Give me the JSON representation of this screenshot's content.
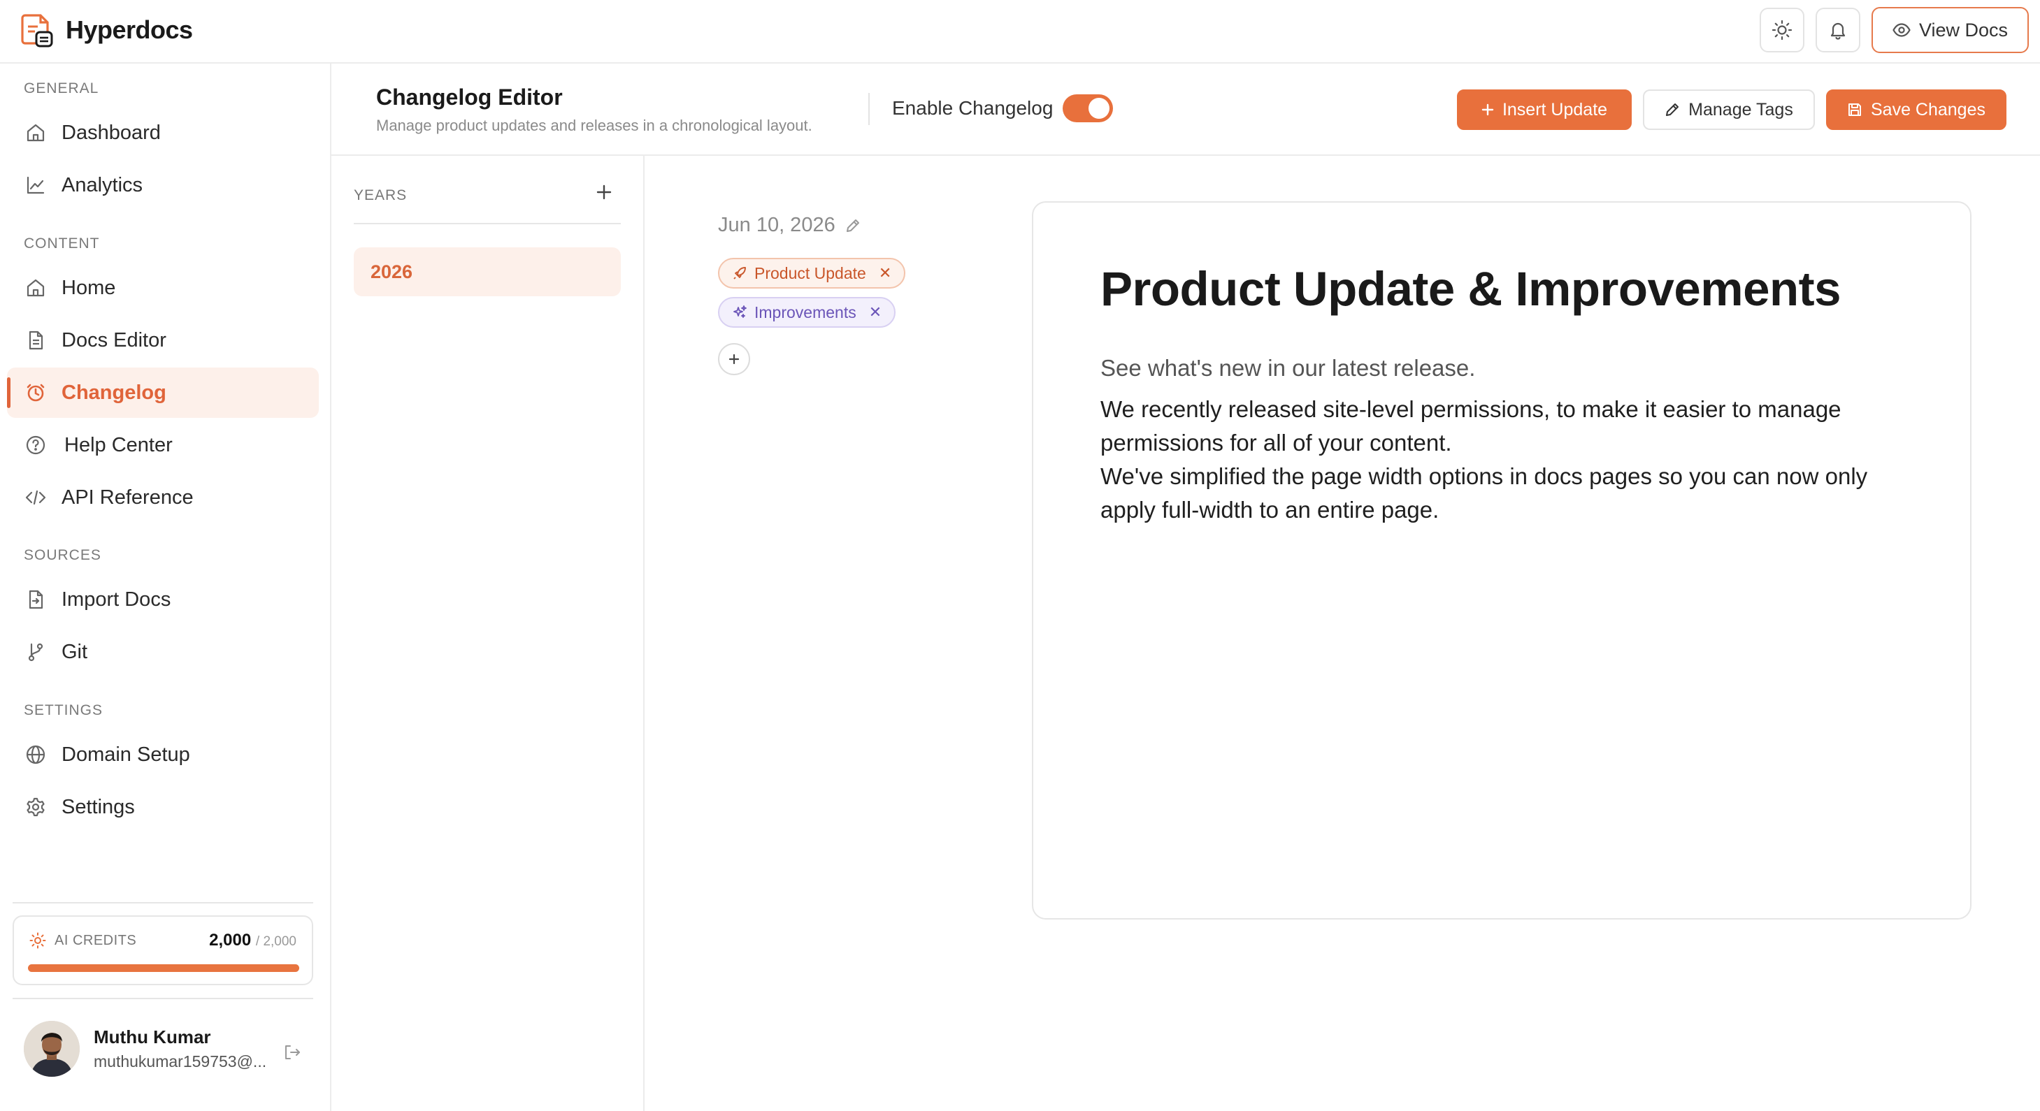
{
  "app": {
    "name": "Hyperdocs"
  },
  "topbar": {
    "view_docs_label": "View Docs"
  },
  "sidebar": {
    "sections": {
      "general": "GENERAL",
      "content": "CONTENT",
      "sources": "SOURCES",
      "settings": "SETTINGS"
    },
    "items": [
      {
        "label": "Dashboard",
        "icon": "home-icon"
      },
      {
        "label": "Analytics",
        "icon": "line-chart-icon"
      },
      {
        "label": "Home",
        "icon": "home-icon"
      },
      {
        "label": "Docs Editor",
        "icon": "document-icon"
      },
      {
        "label": "Changelog",
        "icon": "clock-icon",
        "active": true
      },
      {
        "label": "Help Center",
        "icon": "help-circle-icon"
      },
      {
        "label": "API Reference",
        "icon": "code-icon"
      },
      {
        "label": "Import Docs",
        "icon": "file-import-icon"
      },
      {
        "label": "Git",
        "icon": "git-branch-icon"
      },
      {
        "label": "Domain Setup",
        "icon": "globe-icon"
      },
      {
        "label": "Settings",
        "icon": "gear-icon"
      }
    ],
    "credits": {
      "label": "AI CREDITS",
      "value": "2,000",
      "max": "/ 2,000",
      "fraction": 1.0
    },
    "user": {
      "name": "Muthu Kumar",
      "email": "muthukumar159753@..."
    }
  },
  "header": {
    "title": "Changelog Editor",
    "subtitle": "Manage product updates and releases in a chronological layout.",
    "toggle_label": "Enable Changelog",
    "toggle_on": true,
    "buttons": {
      "insert": "Insert Update",
      "manage_tags": "Manage Tags",
      "save": "Save Changes"
    }
  },
  "years": {
    "label": "YEARS",
    "items": [
      "2026"
    ],
    "selected": "2026"
  },
  "entry": {
    "date": "Jun 10, 2026",
    "tags": [
      {
        "label": "Product Update",
        "icon": "rocket-icon",
        "color": "#e0643a"
      },
      {
        "label": "Improvements",
        "icon": "sparkles-icon",
        "color": "#6b55b8"
      }
    ],
    "title": "Product Update & Improvements",
    "lead": "See what's new in our latest release.",
    "body_lines": [
      "We recently released site-level permissions, to make it easier to manage",
      "permissions for all of your content.",
      "We've simplified the page width options in docs pages so you can now only",
      "apply full-width to an entire page."
    ]
  },
  "colors": {
    "accent": "#e8703c",
    "accent_soft": "#fdf0ea",
    "border": "#ececec"
  }
}
